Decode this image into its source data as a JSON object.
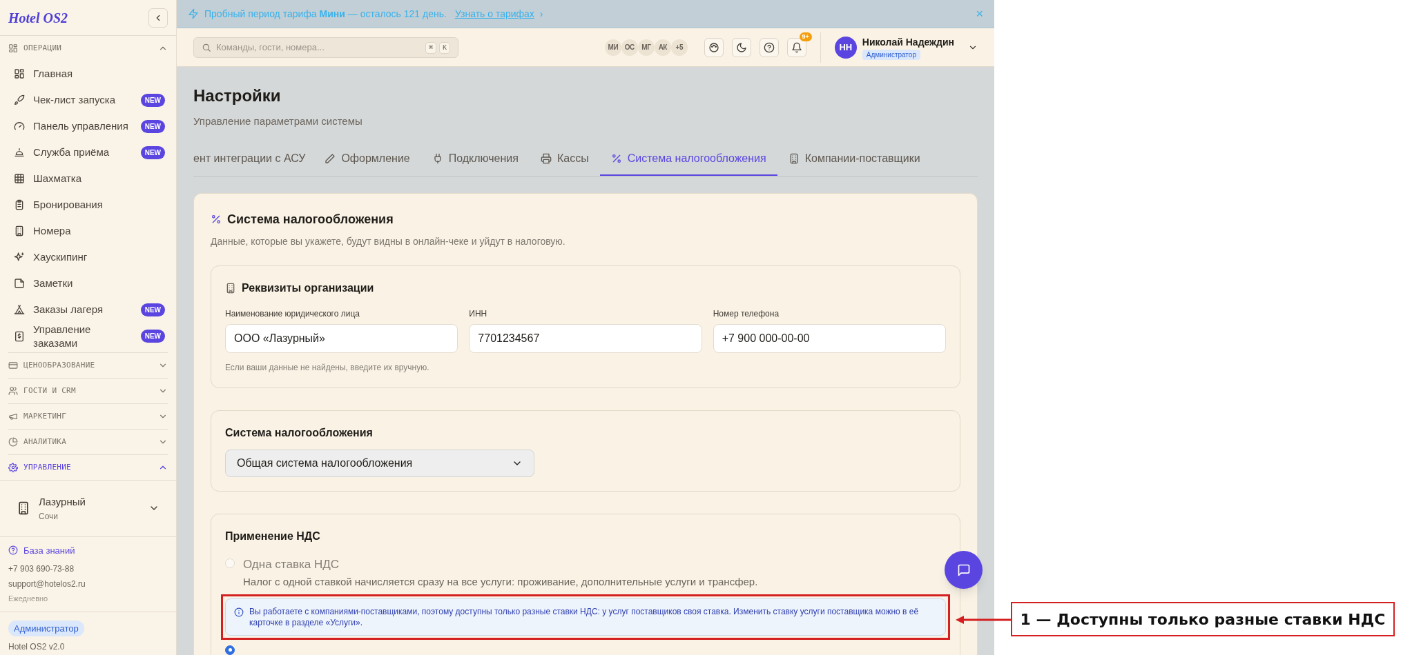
{
  "sidebar": {
    "logo": "Hotel OS2",
    "sections": [
      {
        "title": "ОПЕРАЦИИ",
        "expanded": true,
        "active": false,
        "items": [
          {
            "label": "Главная"
          },
          {
            "label": "Чек-лист запуска",
            "badge": "NEW"
          },
          {
            "label": "Панель управления",
            "badge": "NEW"
          },
          {
            "label": "Служба приёма",
            "badge": "NEW"
          },
          {
            "label": "Шахматка"
          },
          {
            "label": "Бронирования"
          },
          {
            "label": "Номера"
          },
          {
            "label": "Хаускипинг"
          },
          {
            "label": "Заметки"
          },
          {
            "label": "Заказы лагеря",
            "badge": "NEW"
          },
          {
            "label": "Управление заказами",
            "badge": "NEW"
          }
        ]
      },
      {
        "title": "ЦЕНООБРАЗОВАНИЕ",
        "expanded": false,
        "active": false
      },
      {
        "title": "ГОСТИ И CRM",
        "expanded": false,
        "active": false
      },
      {
        "title": "МАРКЕТИНГ",
        "expanded": false,
        "active": false
      },
      {
        "title": "АНАЛИТИКА",
        "expanded": false,
        "active": false
      },
      {
        "title": "УПРАВЛЕНИЕ",
        "expanded": true,
        "active": true
      }
    ],
    "property": {
      "name": "Лазурный",
      "city": "Сочи"
    },
    "help": {
      "link": "База знаний",
      "phone": "+7 903 690-73-88",
      "email": "support@hotelos2.ru",
      "hours": "Ежедневно"
    },
    "role": "Администратор",
    "version": "Hotel OS2 v2.0"
  },
  "banner": {
    "text": "Пробный период тарифа **Мини** — осталось 121 день.",
    "link": "Узнать о тарифах",
    "chevron": "›",
    "close": "×"
  },
  "topbar": {
    "search": {
      "placeholder": "Команды, гости, номера..."
    },
    "shortcut": [
      "⌘",
      "K"
    ],
    "avatars": [
      "МИ",
      "ОС",
      "МГ",
      "АК",
      "+5"
    ],
    "notifications": "9+",
    "user": {
      "initials": "НН",
      "name": "Николай Надеждин",
      "role": "Администратор"
    }
  },
  "page": {
    "title": "Настройки",
    "subtitle": "Управление параметрами системы"
  },
  "tabs": [
    {
      "label": "ент интеграции с АСУ",
      "selected": false
    },
    {
      "label": "Оформление",
      "selected": false
    },
    {
      "label": "Подключения",
      "selected": false
    },
    {
      "label": "Кассы",
      "selected": false
    },
    {
      "label": "Система налогообложения",
      "selected": true
    },
    {
      "label": "Компании-поставщики",
      "selected": false
    }
  ],
  "card": {
    "title": "Система налогообложения",
    "description": "Данные, которые вы укажете, будут видны в онлайн-чеке и уйдут в налоговую.",
    "org": {
      "title": "Реквизиты организации",
      "fields": [
        {
          "label": "Наименование юридического лица",
          "value": "ООО «Лазурный»"
        },
        {
          "label": "ИНН",
          "value": "7701234567"
        },
        {
          "label": "Номер телефона",
          "value": "+7 900 000-00-00"
        }
      ],
      "hint": "Если ваши данные не найдены, введите их вручную."
    },
    "tax": {
      "title": "Система налогообложения",
      "value": "Общая система налогообложения"
    },
    "vat": {
      "title": "Применение НДС",
      "options": [
        {
          "label": "Одна ставка НДС",
          "description": "Налог с одной ставкой начисляется сразу на все услуги: проживание, дополнительные услуги и трансфер.",
          "selected": false,
          "disabled": true
        },
        {
          "selected": true,
          "disabled": false
        }
      ],
      "notice": "Вы работаете с компаниями-поставщиками, поэтому доступны только разные ставки НДС: у услуг поставщиков своя ставка. Изменить ставку услуги поставщика можно в её карточке в разделе «Услуги»."
    }
  },
  "annotation": {
    "label": "1 — Доступны только разные ставки НДС"
  }
}
